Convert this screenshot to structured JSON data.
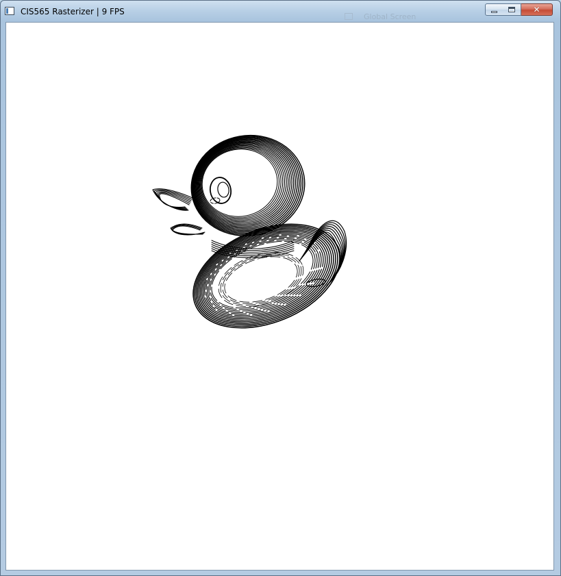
{
  "window": {
    "title": "CIS565 Rasterizer | 9 FPS",
    "background_window_title": "Global Screen"
  },
  "controls": {
    "minimize_icon": "minimize-icon",
    "maximize_icon": "maximize-icon",
    "close_icon": "close-icon",
    "close_glyph": "✕"
  },
  "viewport": {
    "background": "#ffffff",
    "render": "rubber duck model rendered as black contour lines"
  },
  "colors": {
    "close_button": "#c44b35",
    "line": "#000000"
  }
}
